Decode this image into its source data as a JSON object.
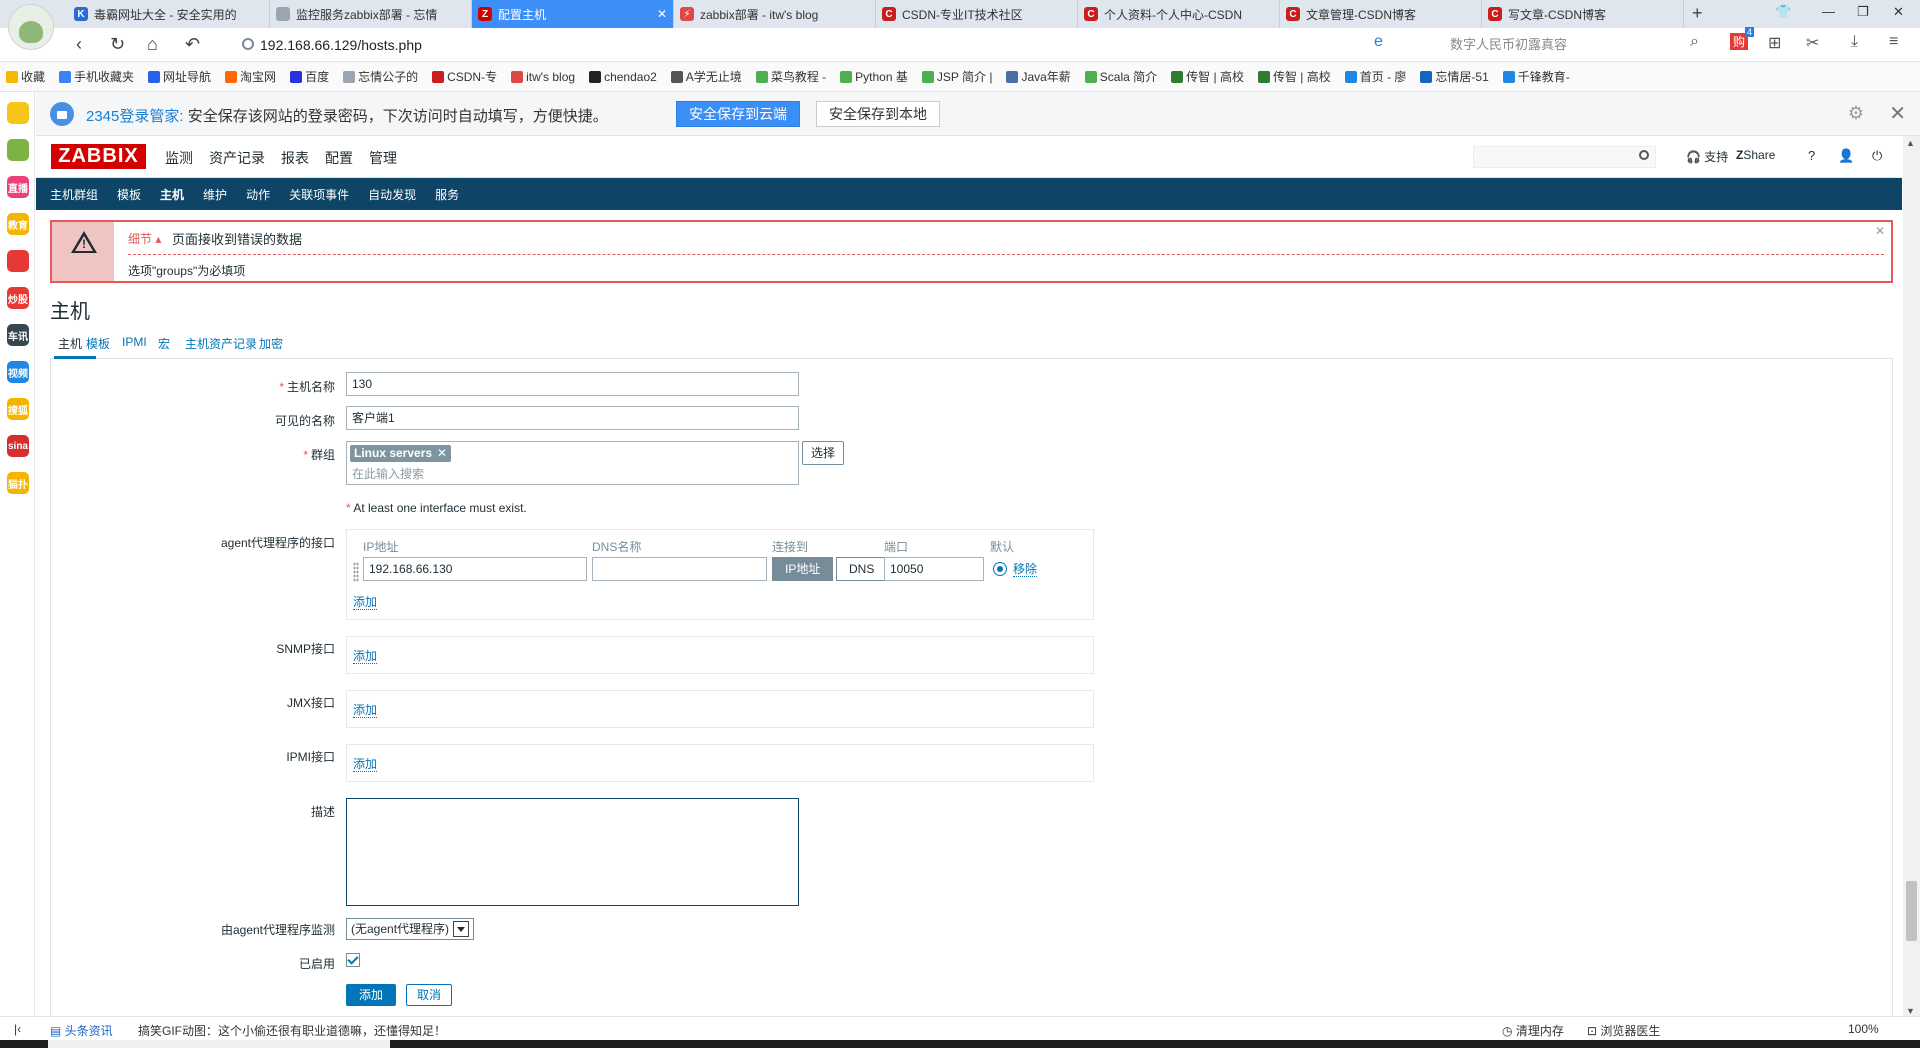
{
  "browser": {
    "tabs": [
      {
        "label": "毒霸网址大全 - 安全实用的",
        "icon_color": "#2b6cd4",
        "icon_text": "K"
      },
      {
        "label": "监控服务zabbix部署 - 忘情",
        "icon_color": "#9aa5b1",
        "icon_text": ""
      },
      {
        "label": "配置主机",
        "icon_color": "#d40000",
        "icon_text": "Z"
      },
      {
        "label": "zabbix部署 - itw's blog",
        "icon_color": "#e04848",
        "icon_text": "⚡"
      },
      {
        "label": "CSDN-专业IT技术社区",
        "icon_color": "#c81e1e",
        "icon_text": "C"
      },
      {
        "label": "个人资料-个人中心-CSDN",
        "icon_color": "#c81e1e",
        "icon_text": "C"
      },
      {
        "label": "文章管理-CSDN博客",
        "icon_color": "#c81e1e",
        "icon_text": "C"
      },
      {
        "label": "写文章-CSDN博客",
        "icon_color": "#c81e1e",
        "icon_text": "C"
      }
    ],
    "active_tab": 2,
    "url": "192.168.66.129/hosts.php",
    "search_placeholder": "数字人民币初露真容",
    "download_badge": "4",
    "bookmarks": [
      {
        "label": "收藏",
        "color": "#f5b800"
      },
      {
        "label": "手机收藏夹",
        "color": "#3b82f6"
      },
      {
        "label": "网址导航",
        "color": "#2563eb"
      },
      {
        "label": "淘宝网",
        "color": "#ff6a00"
      },
      {
        "label": "百度",
        "color": "#2932e1"
      },
      {
        "label": "忘情公子的",
        "color": "#9aa5b1"
      },
      {
        "label": "CSDN-专",
        "color": "#c81e1e"
      },
      {
        "label": "itw's blog",
        "color": "#e04848"
      },
      {
        "label": "chendao2",
        "color": "#222222"
      },
      {
        "label": "A学无止境",
        "color": "#555555"
      },
      {
        "label": "菜鸟教程 -",
        "color": "#4caf50"
      },
      {
        "label": "Python 基",
        "color": "#4caf50"
      },
      {
        "label": "JSP 简介 |",
        "color": "#4caf50"
      },
      {
        "label": "Java年薪",
        "color": "#4a6fa5"
      },
      {
        "label": "Scala 简介",
        "color": "#4caf50"
      },
      {
        "label": "传智 | 高校",
        "color": "#2e7d32"
      },
      {
        "label": "传智 | 高校",
        "color": "#2e7d32"
      },
      {
        "label": "首页 - 廖",
        "color": "#1e88e5"
      },
      {
        "label": "忘情居-51",
        "color": "#1565c0"
      },
      {
        "label": "千锋教育-",
        "color": "#1e88e5"
      }
    ],
    "sidebar_items": [
      {
        "label": "",
        "color": "#f5c518",
        "name": "favorites-star-icon"
      },
      {
        "label": "",
        "color": "#7cb342",
        "name": "history-clock-icon"
      },
      {
        "label": "直播",
        "color": "#ec407a",
        "name": "sidebar-live"
      },
      {
        "label": "教育",
        "color": "#f4b400",
        "name": "sidebar-education"
      },
      {
        "label": "",
        "color": "#e53935",
        "name": "weibo-icon"
      },
      {
        "label": "炒股",
        "color": "#e53935",
        "name": "sidebar-stocks"
      },
      {
        "label": "车讯",
        "color": "#37474f",
        "name": "sidebar-cars"
      },
      {
        "label": "视频",
        "color": "#1e88e5",
        "name": "sidebar-video"
      },
      {
        "label": "搜狐",
        "color": "#f4b400",
        "name": "sidebar-sohu"
      },
      {
        "label": "sina",
        "color": "#d32f2f",
        "name": "sidebar-sina"
      },
      {
        "label": "猫扑",
        "color": "#f4b400",
        "name": "sidebar-mop"
      }
    ]
  },
  "password_bar": {
    "brand": "2345登录管家:",
    "message": "安全保存该网站的登录密码，下次访问时自动填写，方便快捷。",
    "save_cloud": "安全保存到云端",
    "save_local": "安全保存到本地"
  },
  "zabbix": {
    "logo": "ZABBIX",
    "menu": [
      "监测",
      "资产记录",
      "报表",
      "配置",
      "管理"
    ],
    "menu_selected": 3,
    "support": "支持",
    "share": "Share",
    "help": "?",
    "submenu": [
      "主机群组",
      "模板",
      "主机",
      "维护",
      "动作",
      "关联项事件",
      "自动发现",
      "服务"
    ],
    "submenu_selected": 2
  },
  "error": {
    "details": "细节 ▴",
    "title": "页面接收到错误的数据",
    "message": "选项\"groups\"为必填项"
  },
  "page": {
    "title": "主机",
    "tabs": [
      "主机",
      "模板",
      "IPMI",
      "宏",
      "主机资产记录",
      "加密"
    ],
    "tab_selected": 0
  },
  "form": {
    "host_name_label": "主机名称",
    "host_name_value": "130",
    "visible_name_label": "可见的名称",
    "visible_name_value": "客户端1",
    "groups_label": "群组",
    "group_tag": "Linux servers",
    "group_remove": "✕",
    "group_placeholder": "在此输入搜索",
    "select_button": "选择",
    "interface_note": "At least one interface must exist.",
    "agent_label": "agent代理程序的接口",
    "iface_headers": [
      "IP地址",
      "DNS名称",
      "连接到",
      "端口",
      "默认"
    ],
    "ip_value": "192.168.66.130",
    "dns_value": "",
    "connect_ip": "IP地址",
    "connect_dns": "DNS",
    "port_value": "10050",
    "remove_link": "移除",
    "add_link": "添加",
    "snmp_label": "SNMP接口",
    "jmx_label": "JMX接口",
    "ipmi_label": "IPMI接口",
    "description_label": "描述",
    "proxy_label": "由agent代理程序监测",
    "proxy_value": "(无agent代理程序)",
    "enabled_label": "已启用",
    "submit": "添加",
    "cancel": "取消"
  },
  "statusbar": {
    "news": "头条资讯",
    "ticker": "搞笑GIF动图：这个小偷还很有职业道德嘛，还懂得知足！",
    "clear_memory": "清理内存",
    "browser_doctor": "浏览器医生",
    "zoom": "100%"
  }
}
